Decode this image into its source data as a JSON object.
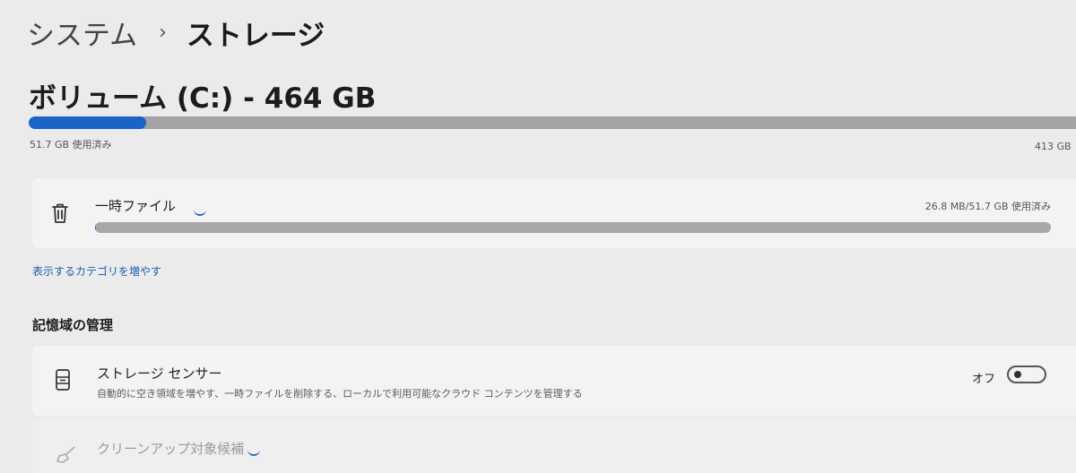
{
  "breadcrumb": {
    "parent": "システム",
    "separator": "›",
    "current": "ストレージ"
  },
  "volume": {
    "title": "ボリューム (C:) - 464 GB",
    "used_label": "51.7 GB 使用済み",
    "free_label": "413 GB",
    "used_fraction": 0.111
  },
  "categories": [
    {
      "icon": "trash-icon",
      "label": "一時ファイル",
      "usage": "26.8 MB/51.7 GB 使用済み",
      "used_fraction": 0.0005
    }
  ],
  "more_categories_link": "表示するカテゴリを増やす",
  "storage_management": {
    "heading": "記憶域の管理",
    "storage_sense": {
      "icon": "storage-sense-icon",
      "title": "ストレージ センサー",
      "description": "自動的に空き領域を増やす、一時ファイルを削除する、ローカルで利用可能なクラウド コンテンツを管理する",
      "toggle_label": "オフ",
      "toggle_on": false
    },
    "cleanup": {
      "icon": "broom-icon",
      "title": "クリーンアップ対象候補"
    }
  },
  "colors": {
    "accent": "#1c63c8",
    "background": "#ebebeb",
    "card": "#f3f3f3",
    "link": "#1b5fb4"
  }
}
